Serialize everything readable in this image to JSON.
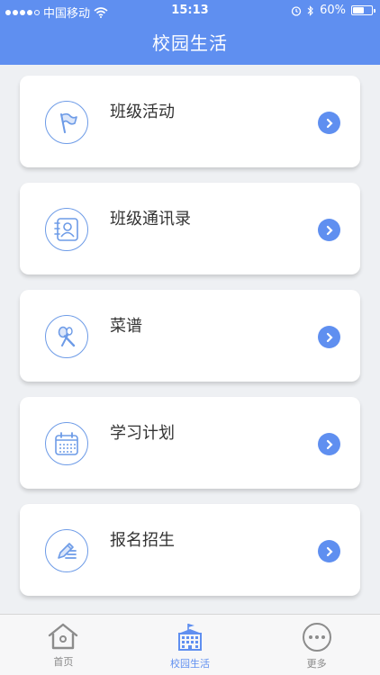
{
  "status": {
    "carrier": "中国移动",
    "time": "15:13",
    "battery": "60%",
    "battery_level": 0.6
  },
  "header": {
    "title": "校园生活"
  },
  "items": [
    {
      "label": "班级活动",
      "icon": "flag-icon"
    },
    {
      "label": "班级通讯录",
      "icon": "contacts-book-icon"
    },
    {
      "label": "菜谱",
      "icon": "spoon-icon"
    },
    {
      "label": "学习计划",
      "icon": "calendar-icon"
    },
    {
      "label": "报名招生",
      "icon": "edit-list-icon"
    }
  ],
  "tabs": [
    {
      "label": "首页",
      "icon": "home-icon",
      "active": false
    },
    {
      "label": "校园生活",
      "icon": "campus-building-icon",
      "active": true
    },
    {
      "label": "更多",
      "icon": "more-icon",
      "active": false
    }
  ],
  "colors": {
    "accent": "#5f8ff0",
    "icon_stroke": "#6d9be7",
    "inactive": "#888888"
  }
}
